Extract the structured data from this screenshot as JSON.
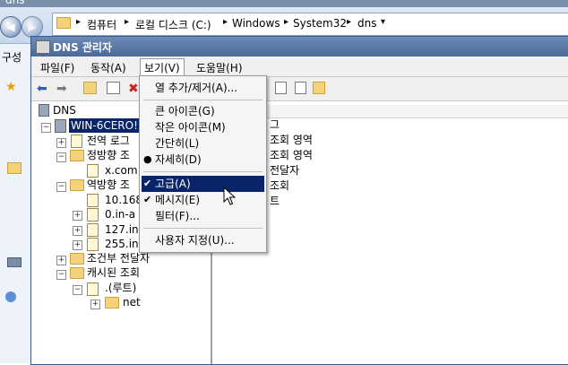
{
  "explorer": {
    "title": "dns",
    "breadcrumb": [
      "컴퓨터",
      "로컬 디스크 (C:)",
      "Windows",
      "System32",
      "dns"
    ],
    "left_label": "구성"
  },
  "window": {
    "title": "DNS 관리자"
  },
  "menubar": {
    "items": [
      {
        "label": "파일(F)"
      },
      {
        "label": "동작(A)"
      },
      {
        "label": "보기(V)"
      },
      {
        "label": "도움말(H)"
      }
    ]
  },
  "tree": {
    "root": "DNS",
    "server": "WIN-6CERO!",
    "nodes": [
      {
        "label": "전역 로그"
      },
      {
        "label": "정방향 조"
      },
      {
        "label": "x.com"
      },
      {
        "label": "역방향 조"
      },
      {
        "label": "10.168"
      },
      {
        "label": "0.in-a"
      },
      {
        "label": "127.in-"
      },
      {
        "label": "255.in-"
      },
      {
        "label": "조건부 전달자"
      },
      {
        "label": "캐시된 조회"
      },
      {
        "label": ".(루트)"
      },
      {
        "label": "net"
      }
    ]
  },
  "list": {
    "items": [
      "그",
      "조회 영역",
      "조회 영역",
      "전달자",
      "조회",
      "트"
    ]
  },
  "dropdown": {
    "items": [
      {
        "label": "열 추가/제거(A)..."
      },
      {
        "label": "큰 아이콘(G)"
      },
      {
        "label": "작은 아이콘(M)"
      },
      {
        "label": "간단히(L)"
      },
      {
        "label": "자세히(D)",
        "bullet": "●"
      },
      {
        "label": "고급(A)",
        "check": "✔"
      },
      {
        "label": "메시지(E)",
        "check": "✔"
      },
      {
        "label": "필터(F)..."
      },
      {
        "label": "사용자 지정(U)..."
      }
    ]
  },
  "colors": {
    "accent": "#0a246a",
    "title_bar": "#4a6a98"
  }
}
